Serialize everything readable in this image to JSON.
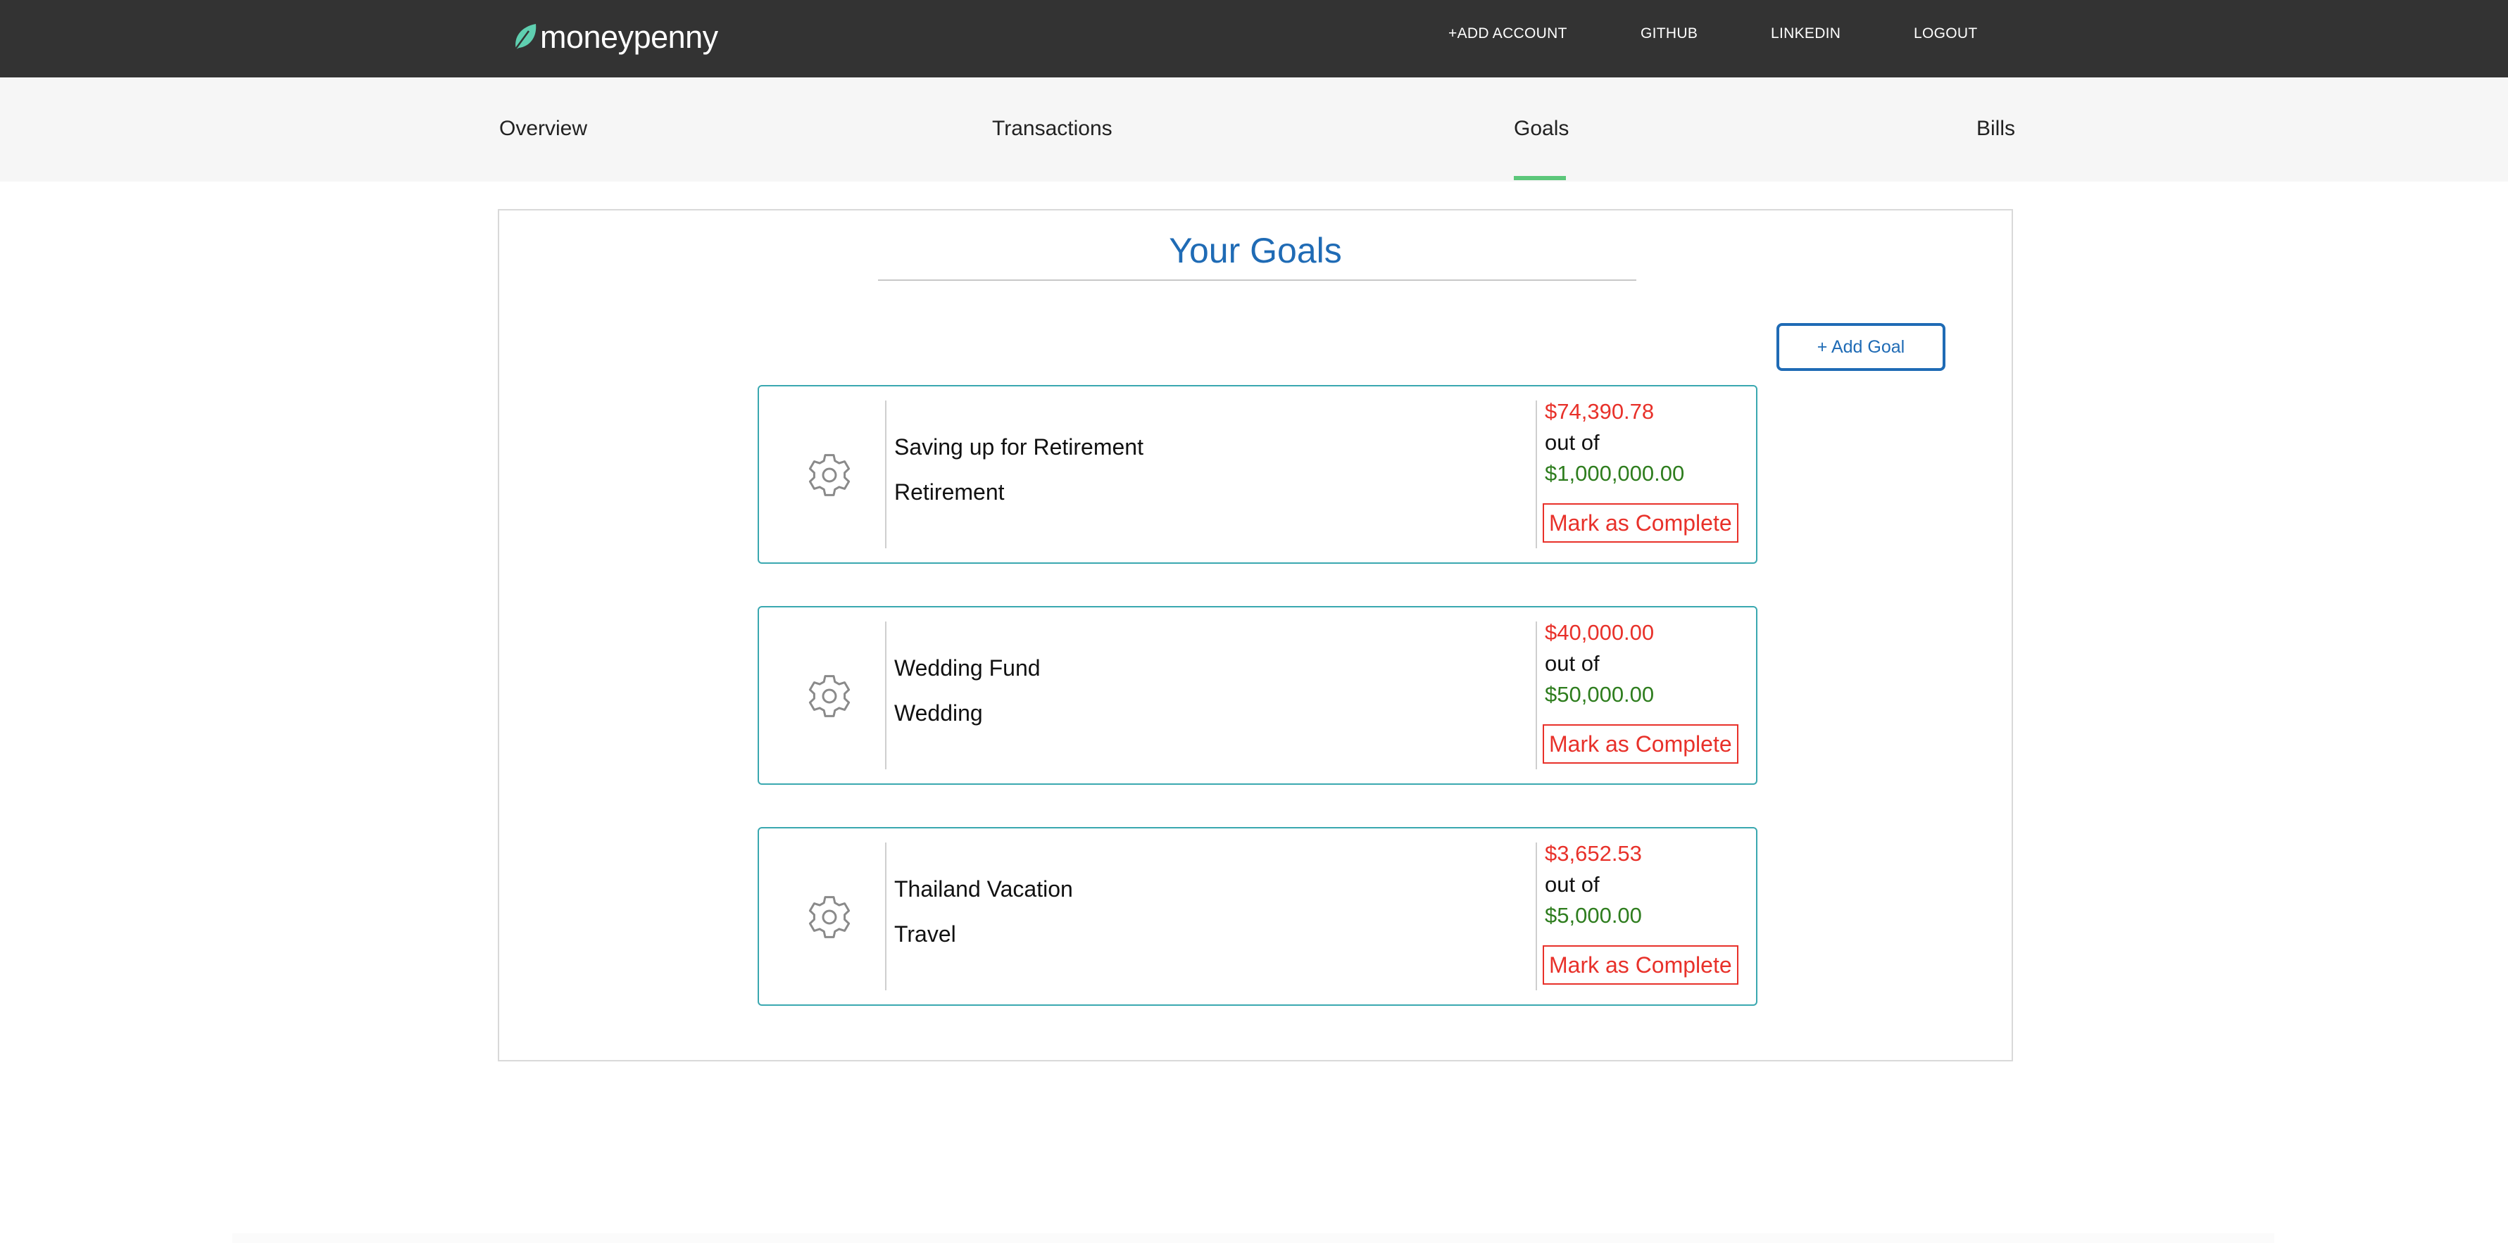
{
  "header": {
    "brand": "moneypenny",
    "nav": [
      "+ADD ACCOUNT",
      "GITHUB",
      "LINKEDIN",
      "LOGOUT"
    ]
  },
  "tabs": [
    "Overview",
    "Transactions",
    "Goals",
    "Bills"
  ],
  "active_tab": "Goals",
  "page": {
    "title": "Your Goals",
    "add_goal_label": "+ Add Goal",
    "out_of_label": "out of",
    "mark_complete_label": "Mark as Complete"
  },
  "goals": [
    {
      "name": "Saving up for Retirement",
      "category": "Retirement",
      "saved": "$74,390.78",
      "target": "$1,000,000.00"
    },
    {
      "name": "Wedding Fund",
      "category": "Wedding",
      "saved": "$40,000.00",
      "target": "$50,000.00"
    },
    {
      "name": "Thailand Vacation",
      "category": "Travel",
      "saved": "$3,652.53",
      "target": "$5,000.00"
    }
  ],
  "colors": {
    "topbar": "#333333",
    "accent_blue": "#1f6bb5",
    "card_border": "#3aa8b0",
    "saved_red": "#e8312a",
    "target_green": "#2e7d1e",
    "active_tab_underline": "#5cc77a"
  },
  "icons": {
    "brand": "leaf-icon",
    "goal": "gear-icon"
  }
}
